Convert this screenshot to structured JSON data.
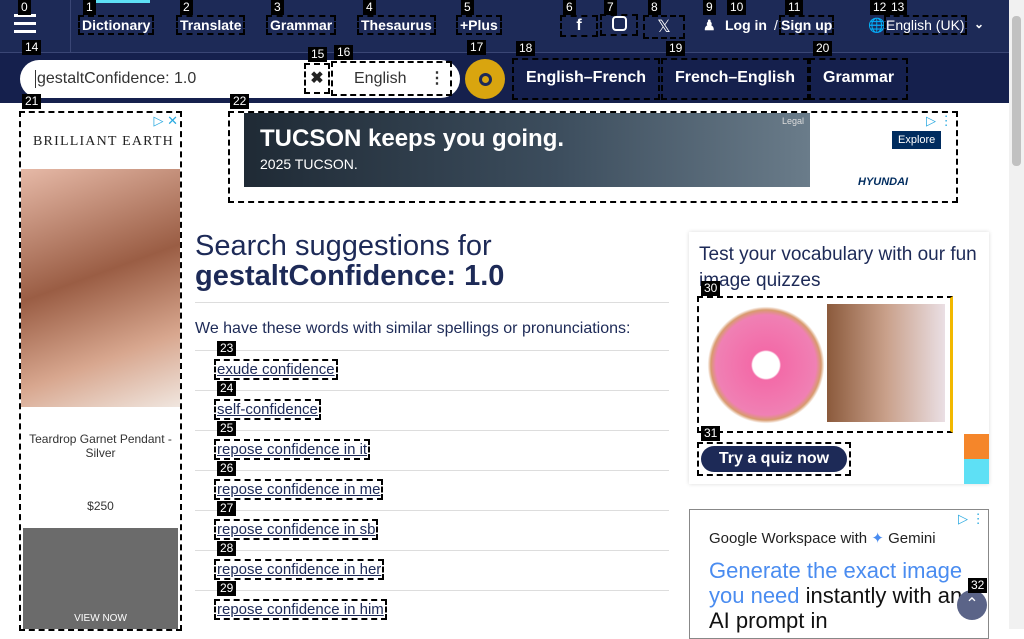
{
  "header": {
    "nav": [
      "Dictionary",
      "Translate",
      "Grammar",
      "Thesaurus",
      "+Plus"
    ],
    "login": "Log in",
    "slash": "/",
    "signup": "Sign up",
    "language": "English (UK)"
  },
  "search": {
    "value": "gestaltConfidence: 1.0",
    "dictionary": "English"
  },
  "quicklinks": [
    "English–French",
    "French–English",
    "Grammar"
  ],
  "left_ad": {
    "brand": "BRILLIANT EARTH",
    "product": "Teardrop Garnet Pendant - Silver",
    "price": "$250",
    "cta": "VIEW NOW"
  },
  "top_ad": {
    "headline": "TUCSON keeps you going.",
    "sub": "2025 TUCSON.",
    "legal": "Legal",
    "cta": "Explore",
    "brand": "HYUNDAI"
  },
  "main": {
    "title_prefix": "Search suggestions for",
    "query": "gestaltConfidence: 1.0",
    "intro": "We have these words with similar spellings or pronunciations:",
    "suggestions": [
      "exude confidence",
      "self-confidence",
      "repose confidence in it",
      "repose confidence in me",
      "repose confidence in sb",
      "repose confidence in her",
      "repose confidence in him"
    ]
  },
  "quiz": {
    "title": "Test your vocabulary with our fun image quizzes",
    "button": "Try a quiz now"
  },
  "right_ad": {
    "brand": "Google Workspace with",
    "brand2": "Gemini",
    "blue": "Generate the exact image you need",
    "rest": "instantly with an AI prompt in"
  },
  "colors": {
    "header": "#1d2a57",
    "accent": "#d9a50f",
    "cyan": "#5ee0f5"
  }
}
